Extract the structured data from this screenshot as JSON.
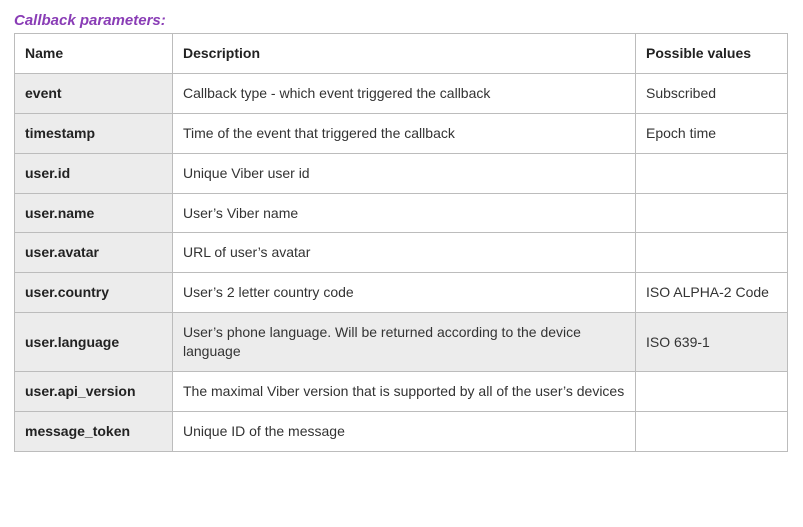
{
  "title": "Callback parameters:",
  "columns": {
    "name": "Name",
    "description": "Description",
    "possible": "Possible values"
  },
  "rows": [
    {
      "name": "event",
      "description": "Callback type - which event triggered the callback",
      "possible": "Subscribed",
      "shaded": false
    },
    {
      "name": "timestamp",
      "description": "Time of the event that triggered the callback",
      "possible": "Epoch time",
      "shaded": false
    },
    {
      "name": "user.id",
      "description": "Unique Viber user id",
      "possible": "",
      "shaded": false
    },
    {
      "name": "user.name",
      "description": "User’s Viber name",
      "possible": "",
      "shaded": false
    },
    {
      "name": "user.avatar",
      "description": "URL of user’s avatar",
      "possible": "",
      "shaded": false
    },
    {
      "name": "user.country",
      "description": "User’s 2 letter country code",
      "possible": "ISO ALPHA-2 Code",
      "shaded": false
    },
    {
      "name": "user.language",
      "description": "User’s phone language. Will be returned according to the device language",
      "possible": "ISO 639-1",
      "shaded": true
    },
    {
      "name": "user.api_version",
      "description": "The maximal Viber version that is supported by all of the user’s devices",
      "possible": "",
      "shaded": false
    },
    {
      "name": "message_token",
      "description": "Unique ID of the message",
      "possible": "",
      "shaded": false
    }
  ]
}
